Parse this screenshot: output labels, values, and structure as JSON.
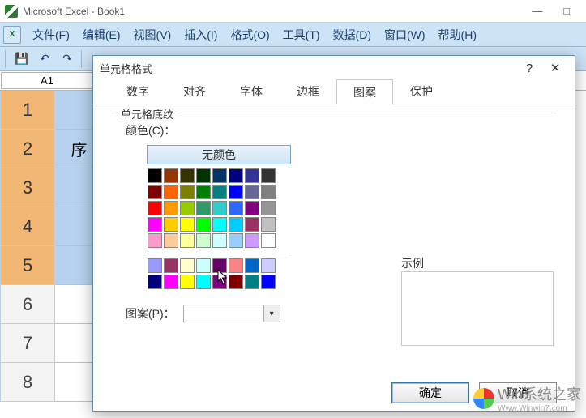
{
  "window": {
    "title": "Microsoft Excel - Book1"
  },
  "menu": {
    "file": "文件(F)",
    "edit": "编辑(E)",
    "view": "视图(V)",
    "insert": "插入(I)",
    "format": "格式(O)",
    "tools": "工具(T)",
    "data": "数据(D)",
    "window": "窗口(W)",
    "help": "帮助(H)"
  },
  "nameBox": "A1",
  "rows": {
    "r1": "1",
    "r2": "2",
    "r3": "3",
    "r4": "4",
    "r5": "5",
    "r6": "6",
    "r7": "7",
    "r8": "8"
  },
  "cells": {
    "b2": "序"
  },
  "dialog": {
    "title": "单元格格式",
    "tabs": {
      "number": "数字",
      "align": "对齐",
      "font": "字体",
      "border": "边框",
      "pattern": "图案",
      "protect": "保护"
    },
    "group": "单元格底纹",
    "colorLabel": "颜色(C)：",
    "noColor": "无颜色",
    "patternLabel": "图案(P)：",
    "sampleLabel": "示例",
    "ok": "确定",
    "cancel": "取消"
  },
  "palette": {
    "main": [
      [
        "#000000",
        "#993300",
        "#333300",
        "#003300",
        "#003366",
        "#000080",
        "#333399",
        "#333333"
      ],
      [
        "#800000",
        "#ff6600",
        "#808000",
        "#008000",
        "#008080",
        "#0000ff",
        "#666699",
        "#808080"
      ],
      [
        "#ff0000",
        "#ff9900",
        "#99cc00",
        "#339966",
        "#33cccc",
        "#3366ff",
        "#800080",
        "#969696"
      ],
      [
        "#ff00ff",
        "#ffcc00",
        "#ffff00",
        "#00ff00",
        "#00ffff",
        "#00ccff",
        "#993366",
        "#c0c0c0"
      ],
      [
        "#ff99cc",
        "#ffcc99",
        "#ffff99",
        "#ccffcc",
        "#ccffff",
        "#99ccff",
        "#cc99ff",
        "#ffffff"
      ]
    ],
    "extra": [
      [
        "#9999ff",
        "#993366",
        "#ffffcc",
        "#ccffff",
        "#660066",
        "#ff8080",
        "#0066cc",
        "#ccccff"
      ],
      [
        "#000080",
        "#ff00ff",
        "#ffff00",
        "#00ffff",
        "#800080",
        "#800000",
        "#008080",
        "#0000ff"
      ]
    ]
  },
  "watermark": {
    "brand": "Win系统之家",
    "url": "Www.Winwin7.com"
  }
}
